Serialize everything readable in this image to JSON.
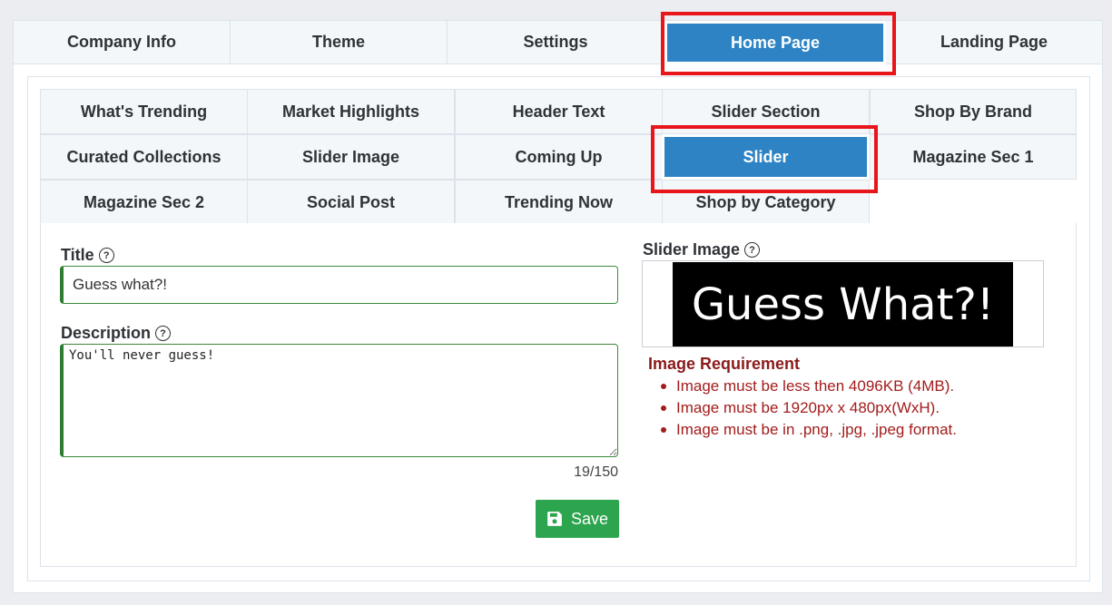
{
  "top_tabs": [
    {
      "label": "Company Info",
      "active": false
    },
    {
      "label": "Theme",
      "active": false
    },
    {
      "label": "Settings",
      "active": false
    },
    {
      "label": "Home Page",
      "active": true
    },
    {
      "label": "Landing Page",
      "active": false
    }
  ],
  "sub_tabs": [
    {
      "label": "What's Trending",
      "active": false
    },
    {
      "label": "Market Highlights",
      "active": false
    },
    {
      "label": "Header Text",
      "active": false
    },
    {
      "label": "Slider Section",
      "active": false
    },
    {
      "label": "Shop By Brand",
      "active": false
    },
    {
      "label": "Curated Collections",
      "active": false
    },
    {
      "label": "Slider Image",
      "active": false
    },
    {
      "label": "Coming Up",
      "active": false
    },
    {
      "label": "Slider",
      "active": true
    },
    {
      "label": "Magazine Sec 1",
      "active": false
    },
    {
      "label": "Magazine Sec 2",
      "active": false
    },
    {
      "label": "Social Post",
      "active": false
    },
    {
      "label": "Trending Now",
      "active": false
    },
    {
      "label": "Shop by Category",
      "active": false
    }
  ],
  "form": {
    "title_label": "Title",
    "title_value": "Guess what?!",
    "description_label": "Description",
    "description_value": "You'll never guess!",
    "counter": "19/150",
    "save_label": "Save"
  },
  "slider_image": {
    "label": "Slider Image",
    "preview_text": "Guess What?!"
  },
  "requirements": {
    "title": "Image Requirement",
    "items": [
      "Image must be less then 4096KB (4MB).",
      "Image must be 1920px x 480px(WxH).",
      "Image must be in .png, .jpg, .jpeg format."
    ]
  },
  "colors": {
    "active_tab": "#2d83c4",
    "highlight": "#e8151a",
    "save_button": "#2da44e",
    "requirement_text": "#a31c1c"
  },
  "icons": {
    "help": "question-circle-icon",
    "save": "floppy-disk-icon"
  }
}
